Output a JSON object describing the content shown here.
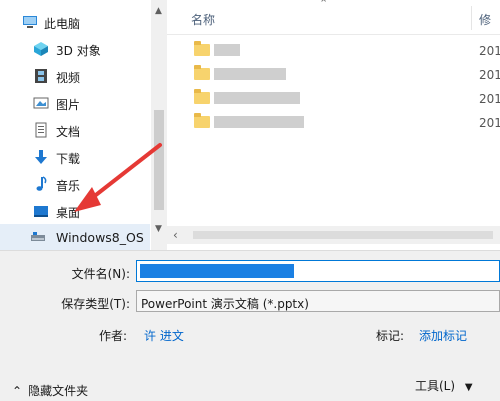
{
  "nav": {
    "items": [
      {
        "label": "此电脑",
        "icon": "computer-icon",
        "top": true
      },
      {
        "label": "3D 对象",
        "icon": "cube-icon"
      },
      {
        "label": "视频",
        "icon": "film-icon"
      },
      {
        "label": "图片",
        "icon": "picture-icon"
      },
      {
        "label": "文档",
        "icon": "document-icon"
      },
      {
        "label": "下载",
        "icon": "download-arrow-icon"
      },
      {
        "label": "音乐",
        "icon": "music-note-icon"
      },
      {
        "label": "桌面",
        "icon": "desktop-icon"
      },
      {
        "label": "Windows8_OS",
        "icon": "drive-icon",
        "selected": true
      }
    ]
  },
  "list": {
    "column_name": "名称",
    "column_date_prefix": "修",
    "rows": [
      {
        "date": "201"
      },
      {
        "date": "201"
      },
      {
        "date": "201"
      },
      {
        "date": "201"
      }
    ]
  },
  "form": {
    "filename_label": "文件名(N):",
    "savetype_label": "保存类型(T):",
    "savetype_value": "PowerPoint 演示文稿 (*.pptx)",
    "author_label": "作者:",
    "author_value": "许 进文",
    "tags_label": "标记:",
    "tags_value": "添加标记"
  },
  "footer": {
    "hide_folders_label": "隐藏文件夹",
    "tools_label": "工具(L)"
  },
  "colors": {
    "accent": "#0078d7",
    "annotation": "#e53935",
    "link": "#0066cc"
  }
}
